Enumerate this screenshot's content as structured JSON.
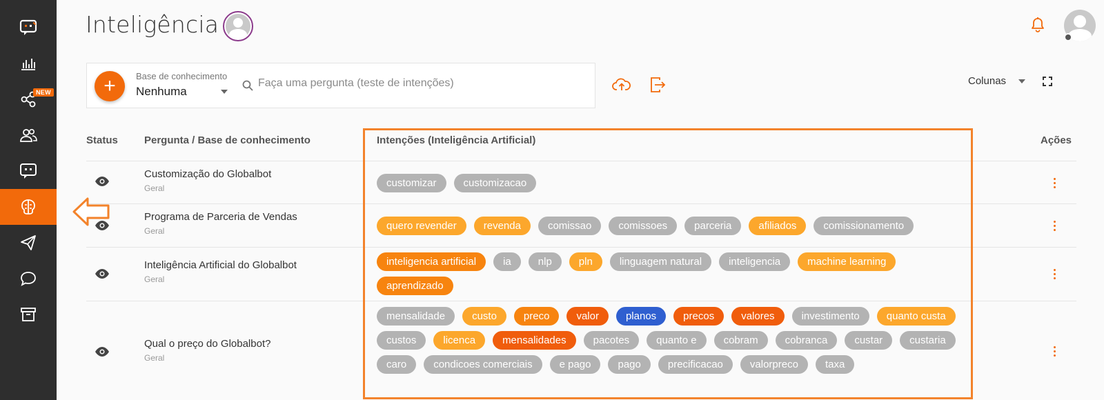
{
  "colors": {
    "accent": "#f26a0b",
    "sidebar_bg": "#2e2e2e",
    "tag_gray": "#b3b3b3",
    "tag_light_orange": "#fca72c",
    "tag_orange": "#f7840f",
    "tag_dark_orange": "#f05d0c",
    "tag_blue": "#2f5fd0"
  },
  "sidebar": {
    "items": [
      {
        "icon": "chatbot-logo-icon"
      },
      {
        "icon": "analytics-icon"
      },
      {
        "icon": "integrations-icon",
        "badge": "NEW"
      },
      {
        "icon": "users-icon"
      },
      {
        "icon": "bots-icon"
      },
      {
        "icon": "brain-icon",
        "active": true
      },
      {
        "icon": "send-icon"
      },
      {
        "icon": "chat-bubble-icon"
      },
      {
        "icon": "archive-icon"
      }
    ]
  },
  "header": {
    "title": "Inteligência"
  },
  "search": {
    "kb_label": "Base de conhecimento",
    "kb_value": "Nenhuma",
    "placeholder": "Faça uma pergunta (teste de intenções)"
  },
  "toolbar": {
    "columns_label": "Colunas"
  },
  "table": {
    "headers": {
      "status": "Status",
      "question": "Pergunta / Base de conhecimento",
      "intents": "Intenções (Inteligência Artificial)",
      "actions": "Ações"
    },
    "rows": [
      {
        "title": "Customização do Globalbot",
        "kb": "Geral",
        "tags": [
          {
            "text": "customizar",
            "color": "gray"
          },
          {
            "text": "customizacao",
            "color": "gray"
          }
        ]
      },
      {
        "title": "Programa de Parceria de Vendas",
        "kb": "Geral",
        "tags": [
          {
            "text": "quero revender",
            "color": "light_orange"
          },
          {
            "text": "revenda",
            "color": "light_orange"
          },
          {
            "text": "comissao",
            "color": "gray"
          },
          {
            "text": "comissoes",
            "color": "gray"
          },
          {
            "text": "parceria",
            "color": "gray"
          },
          {
            "text": "afiliados",
            "color": "light_orange"
          },
          {
            "text": "comissionamento",
            "color": "gray"
          }
        ]
      },
      {
        "title": "Inteligência Artificial do Globalbot",
        "kb": "Geral",
        "tags": [
          {
            "text": "inteligencia artificial",
            "color": "orange"
          },
          {
            "text": "ia",
            "color": "gray"
          },
          {
            "text": "nlp",
            "color": "gray"
          },
          {
            "text": "pln",
            "color": "light_orange"
          },
          {
            "text": "linguagem natural",
            "color": "gray"
          },
          {
            "text": "inteligencia",
            "color": "gray"
          },
          {
            "text": "machine learning",
            "color": "light_orange"
          },
          {
            "text": "aprendizado",
            "color": "orange"
          }
        ]
      },
      {
        "title": "Qual o preço do Globalbot?",
        "kb": "Geral",
        "tags": [
          {
            "text": "mensalidade",
            "color": "gray"
          },
          {
            "text": "custo",
            "color": "light_orange"
          },
          {
            "text": "preco",
            "color": "orange"
          },
          {
            "text": "valor",
            "color": "dark_orange"
          },
          {
            "text": "planos",
            "color": "blue"
          },
          {
            "text": "precos",
            "color": "dark_orange"
          },
          {
            "text": "valores",
            "color": "dark_orange"
          },
          {
            "text": "investimento",
            "color": "gray"
          },
          {
            "text": "quanto custa",
            "color": "light_orange"
          },
          {
            "text": "custos",
            "color": "gray"
          },
          {
            "text": "licenca",
            "color": "light_orange"
          },
          {
            "text": "mensalidades",
            "color": "dark_orange"
          },
          {
            "text": "pacotes",
            "color": "gray"
          },
          {
            "text": "quanto e",
            "color": "gray"
          },
          {
            "text": "cobram",
            "color": "gray"
          },
          {
            "text": "cobranca",
            "color": "gray"
          },
          {
            "text": "custar",
            "color": "gray"
          },
          {
            "text": "custaria",
            "color": "gray"
          },
          {
            "text": "caro",
            "color": "gray"
          },
          {
            "text": "condicoes comerciais",
            "color": "gray"
          },
          {
            "text": "e pago",
            "color": "gray"
          },
          {
            "text": "pago",
            "color": "gray"
          },
          {
            "text": "precificacao",
            "color": "gray"
          },
          {
            "text": "valorpreco",
            "color": "gray"
          },
          {
            "text": "taxa",
            "color": "gray"
          }
        ]
      }
    ]
  }
}
